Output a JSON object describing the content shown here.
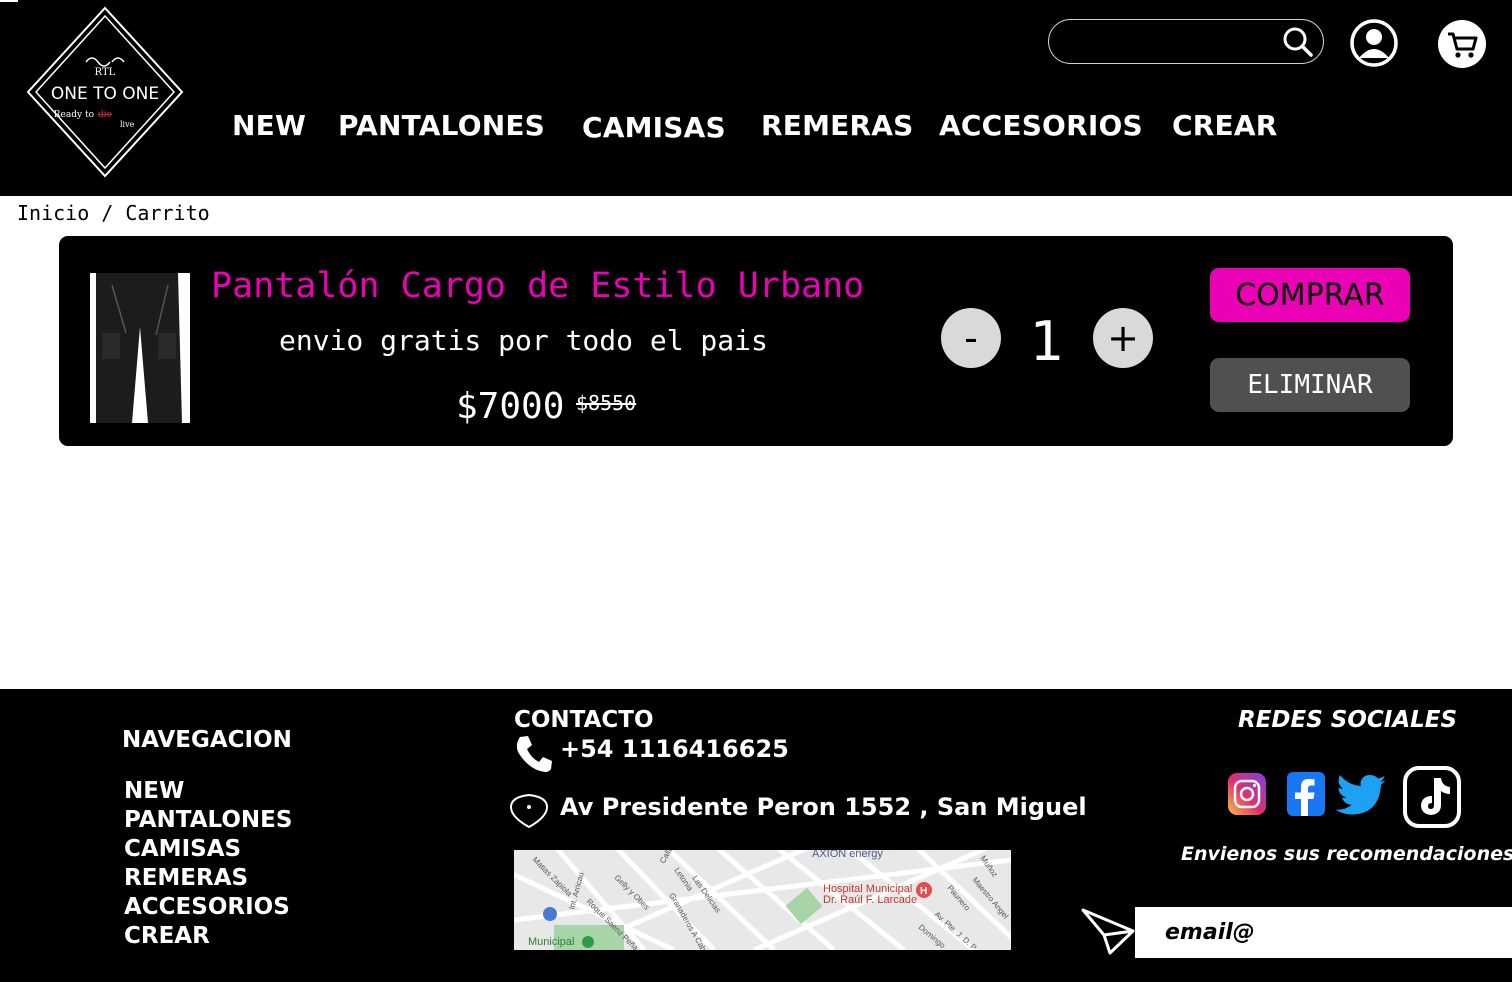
{
  "header": {
    "logo": {
      "top": "RTL",
      "name": "ONE TO ONE",
      "tagline_a": "Ready to",
      "tagline_strike": "die",
      "tagline_b": "live"
    },
    "nav": [
      {
        "label": "NEW"
      },
      {
        "label": "PANTALONES"
      },
      {
        "label": "CAMISAS"
      },
      {
        "label": "REMERAS"
      },
      {
        "label": "ACCESORIOS"
      },
      {
        "label": "CREAR"
      }
    ],
    "search": {
      "placeholder": "",
      "value": ""
    },
    "icons": {
      "search": "search-icon",
      "user": "user-icon",
      "cart": "cart-icon"
    }
  },
  "breadcrumb": "Inicio / Carrito",
  "cart": {
    "item": {
      "title": "Pantalón Cargo de Estilo Urbano",
      "shipping": "envio gratis por todo el pais",
      "price": "$7000",
      "old_price": "$8550",
      "quantity": "1",
      "minus_label": "-",
      "plus_label": "+",
      "buy_label": "COMPRAR",
      "remove_label": "ELIMINAR"
    }
  },
  "footer": {
    "nav_title": "NAVEGACION",
    "nav_items": [
      "NEW",
      "PANTALONES",
      "CAMISAS",
      "REMERAS",
      "ACCESORIOS",
      "CREAR"
    ],
    "contact_title": "CONTACTO",
    "phone": "+54 1116416625",
    "address": "Av Presidente Peron 1552 , San Miguel",
    "map_labels": {
      "hospital_a": "Hospital Municipal",
      "hospital_b": "Dr. Raúl F. Larcade",
      "energy": "AXION energy",
      "municipal": "Municipal",
      "st_1": "Int. Arricau",
      "st_2": "Granaderos A Caball",
      "st_3": "Av. Pte. J. D. P",
      "st_4": "Roque Saenz Peña",
      "st_5": "Gelly y Obes",
      "st_6": "Las Delicias",
      "st_7": "Letonia",
      "st_8": "Callao",
      "st_9": "Maestro Angel",
      "st_10": "Paunero",
      "st_11": "Domingo",
      "st_12": "Muñoz",
      "st_13": "Matias Zapiola"
    },
    "social_title": "REDES SOCIALES",
    "social_icons": [
      "instagram-icon",
      "facebook-icon",
      "twitter-icon",
      "tiktok-icon"
    ],
    "recommend_text": "Envienos sus recomendaciones",
    "email_placeholder": "email@"
  },
  "colors": {
    "accent": "#ea00b5",
    "header_bg": "#000000",
    "remove_btn": "#505050",
    "qty_btn": "#d9d9d9"
  }
}
